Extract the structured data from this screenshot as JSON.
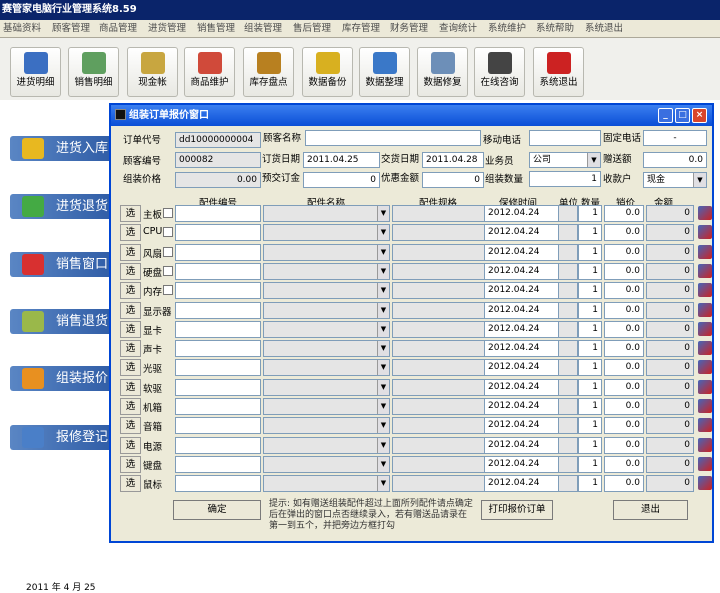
{
  "app": {
    "title": "赛管家电脑行业管理系统8.59"
  },
  "menu": [
    "基础资料",
    "顾客管理",
    "商品管理",
    "进货管理",
    "销售管理",
    "组装管理",
    "售后管理",
    "库存管理",
    "财务管理",
    "查询统计",
    "系统维护",
    "系统帮助",
    "系统退出"
  ],
  "toolbar": [
    {
      "label": "进货明细",
      "icon": "purchase-detail-icon",
      "color": "#3b6fc2"
    },
    {
      "label": "销售明细",
      "icon": "sales-detail-icon",
      "color": "#5f9f5f"
    },
    {
      "label": "现金帐",
      "icon": "cash-ledger-icon",
      "color": "#c8a640"
    },
    {
      "label": "商品维护",
      "icon": "goods-maintain-icon",
      "color": "#d04a3a"
    },
    {
      "label": "库存盘点",
      "icon": "inventory-icon",
      "color": "#b88020"
    },
    {
      "label": "数据备份",
      "icon": "data-backup-icon",
      "color": "#d8b020"
    },
    {
      "label": "数据整理",
      "icon": "data-organize-icon",
      "color": "#3a78c8"
    },
    {
      "label": "数据修复",
      "icon": "data-repair-icon",
      "color": "#6d8fb8"
    },
    {
      "label": "在线咨询",
      "icon": "online-consult-icon",
      "color": "#444444"
    },
    {
      "label": "系统退出",
      "icon": "system-exit-icon",
      "color": "#cc2222"
    }
  ],
  "sidebar": [
    {
      "label": "进货入库",
      "icon": "purchase-in-icon"
    },
    {
      "label": "进货退货",
      "icon": "purchase-return-icon"
    },
    {
      "label": "销售窗口",
      "icon": "sales-window-icon"
    },
    {
      "label": "销售退货",
      "icon": "sales-return-icon"
    },
    {
      "label": "组装报价",
      "icon": "assembly-quote-icon"
    },
    {
      "label": "报修登记",
      "icon": "repair-register-icon"
    }
  ],
  "footer_date": "2011 年   4 月 25",
  "dialog": {
    "title": "组装订单报价窗口",
    "labels": {
      "order_no": "订单代号",
      "customer_name": "顾客名称",
      "mobile": "移动电话",
      "phone": "固定电话",
      "customer_no": "顾客编号",
      "order_date": "订货日期",
      "delivery_date": "交货日期",
      "salesman": "业务员",
      "gift_amount": "赠送额",
      "assembly_price": "组装价格",
      "deposit": "预交订金",
      "discount": "优惠金额",
      "quantity": "组装数量",
      "payee": "收款户"
    },
    "values": {
      "order_no": "dd10000000004",
      "customer_name": "",
      "mobile": "",
      "phone": "-",
      "customer_no": "000082",
      "order_date": "2011.04.25",
      "delivery_date": "2011.04.28",
      "salesman": "公司",
      "gift_amount": "0.0",
      "assembly_price": "0.00",
      "deposit": "0",
      "discount": "0",
      "quantity": "1",
      "payee": "现金"
    },
    "columns": {
      "part_no": "配件编号",
      "part_name": "配件名称",
      "spec": "配件规格",
      "warranty": "保修时间",
      "unit": "单位",
      "qty": "数量",
      "price": "销价",
      "amount": "金额"
    },
    "select_label": "选",
    "rows": [
      {
        "cat": "主板",
        "checkbox": true,
        "warranty": "2012.04.24",
        "qty": "1",
        "price": "0.0",
        "amount": "0"
      },
      {
        "cat": "CPU",
        "checkbox": true,
        "warranty": "2012.04.24",
        "qty": "1",
        "price": "0.0",
        "amount": "0"
      },
      {
        "cat": "风扇",
        "checkbox": true,
        "warranty": "2012.04.24",
        "qty": "1",
        "price": "0.0",
        "amount": "0"
      },
      {
        "cat": "硬盘",
        "checkbox": true,
        "warranty": "2012.04.24",
        "qty": "1",
        "price": "0.0",
        "amount": "0"
      },
      {
        "cat": "内存",
        "checkbox": true,
        "warranty": "2012.04.24",
        "qty": "1",
        "price": "0.0",
        "amount": "0"
      },
      {
        "cat": "显示器",
        "checkbox": false,
        "warranty": "2012.04.24",
        "qty": "1",
        "price": "0.0",
        "amount": "0"
      },
      {
        "cat": "显卡",
        "checkbox": false,
        "warranty": "2012.04.24",
        "qty": "1",
        "price": "0.0",
        "amount": "0"
      },
      {
        "cat": "声卡",
        "checkbox": false,
        "warranty": "2012.04.24",
        "qty": "1",
        "price": "0.0",
        "amount": "0"
      },
      {
        "cat": "光驱",
        "checkbox": false,
        "warranty": "2012.04.24",
        "qty": "1",
        "price": "0.0",
        "amount": "0"
      },
      {
        "cat": "软驱",
        "checkbox": false,
        "warranty": "2012.04.24",
        "qty": "1",
        "price": "0.0",
        "amount": "0"
      },
      {
        "cat": "机箱",
        "checkbox": false,
        "warranty": "2012.04.24",
        "qty": "1",
        "price": "0.0",
        "amount": "0"
      },
      {
        "cat": "音箱",
        "checkbox": false,
        "warranty": "2012.04.24",
        "qty": "1",
        "price": "0.0",
        "amount": "0"
      },
      {
        "cat": "电源",
        "checkbox": false,
        "warranty": "2012.04.24",
        "qty": "1",
        "price": "0.0",
        "amount": "0"
      },
      {
        "cat": "键盘",
        "checkbox": false,
        "warranty": "2012.04.24",
        "qty": "1",
        "price": "0.0",
        "amount": "0"
      },
      {
        "cat": "鼠标",
        "checkbox": false,
        "warranty": "2012.04.24",
        "qty": "1",
        "price": "0.0",
        "amount": "0"
      }
    ],
    "buttons": {
      "confirm": "确定",
      "print": "打印报价订单",
      "exit": "退出"
    },
    "hint": "提示: 如有赠送组装配件超过上面所列配件请点确定后在弹出的窗口点否继续录入，若有赠送品请录在第一到五个，并把旁边方框打勾"
  }
}
